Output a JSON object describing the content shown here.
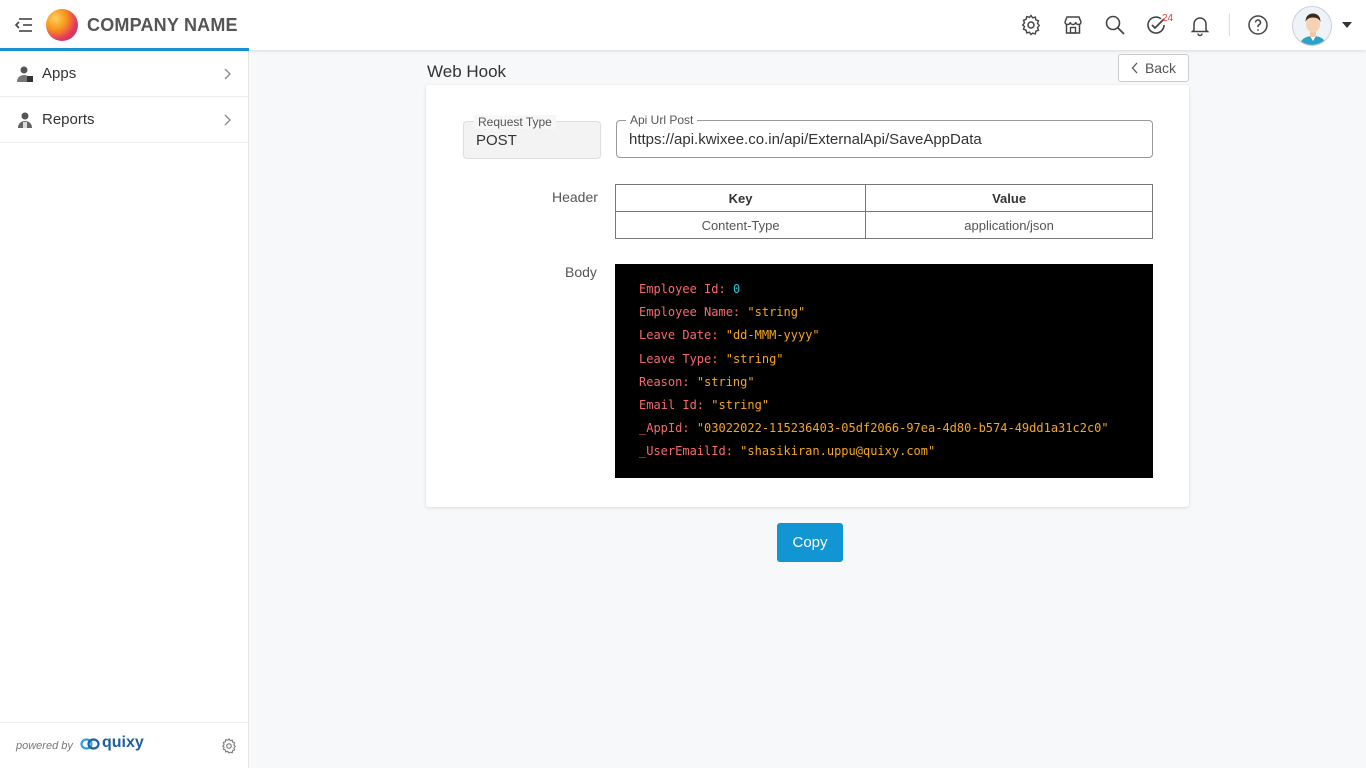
{
  "header": {
    "company_name": "COMPANY NAME",
    "notification_badge": "24",
    "icons": [
      "menu-collapse-icon",
      "settings-icon",
      "store-icon",
      "search-icon",
      "tasks-check-icon",
      "bell-icon",
      "help-icon"
    ]
  },
  "sidebar": {
    "items": [
      {
        "label": "Apps",
        "icon": "apps-user-icon"
      },
      {
        "label": "Reports",
        "icon": "reports-user-icon"
      }
    ],
    "footer": {
      "powered_by": "powered by",
      "brand": "quixy"
    }
  },
  "main": {
    "title": "Web Hook",
    "back_label": "Back",
    "request_type": {
      "label": "Request Type",
      "value": "POST"
    },
    "api_url": {
      "label": "Api Url Post",
      "value": "https://api.kwixee.co.in/api/ExternalApi/SaveAppData"
    },
    "header_label": "Header",
    "header_table": {
      "columns": [
        "Key",
        "Value"
      ],
      "rows": [
        [
          "Content-Type",
          "application/json"
        ]
      ]
    },
    "body_label": "Body",
    "body_lines": [
      {
        "key": "Employee Id:",
        "value": "0",
        "type": "num"
      },
      {
        "key": "Employee Name:",
        "value": "\"string\"",
        "type": "str"
      },
      {
        "key": "Leave Date:",
        "value": "\"dd-MMM-yyyy\"",
        "type": "str"
      },
      {
        "key": "Leave Type:",
        "value": "\"string\"",
        "type": "str"
      },
      {
        "key": "Reason:",
        "value": "\"string\"",
        "type": "str"
      },
      {
        "key": "Email Id:",
        "value": "\"string\"",
        "type": "str"
      },
      {
        "key": "_AppId:",
        "value": "\"03022022-115236403-05df2066-97ea-4d80-b574-49dd1a31c2c0\"",
        "type": "str"
      },
      {
        "key": "_UserEmailId:",
        "value": "\"shasikiran.uppu@quixy.com\"",
        "type": "str"
      }
    ],
    "copy_label": "Copy"
  },
  "colors": {
    "accent": "#1a8fd1",
    "copy_button": "#1295d3",
    "code_background": "#000000",
    "code_key": "#f76a6a",
    "code_string": "#f5a623",
    "code_number": "#26c6da",
    "badge": "#e53935"
  }
}
